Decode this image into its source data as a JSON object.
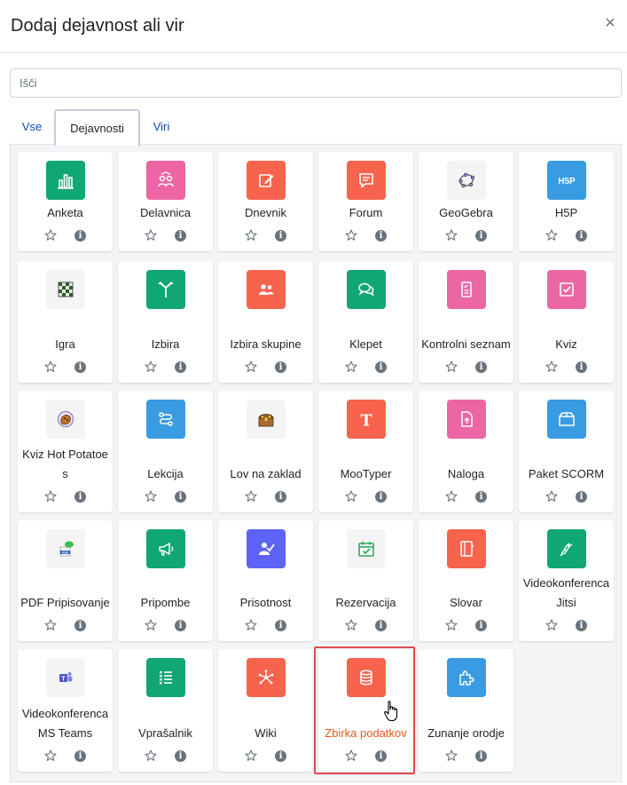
{
  "modal": {
    "title": "Dodaj dejavnost ali vir",
    "close_symbol": "×"
  },
  "search": {
    "placeholder": "Išči"
  },
  "tabs": [
    {
      "label": "Vse"
    },
    {
      "label": "Dejavnosti",
      "active": true
    },
    {
      "label": "Viri"
    }
  ],
  "colors": {
    "assessment": "#f7634d",
    "collaboration": "#eb66a2",
    "communication": "#11a676",
    "content": "#399be2",
    "interactive": "#5d63f6",
    "neutral": "#f4f4f4",
    "highlight_text": "#e6571b",
    "highlight_border": "#e04d4d"
  },
  "activities": [
    {
      "label": "Anketa",
      "icon": "chart-bar-icon",
      "color": "#11a676"
    },
    {
      "label": "Delavnica",
      "icon": "workshop-icon",
      "color": "#eb66a2"
    },
    {
      "label": "Dnevnik",
      "icon": "journal-edit-icon",
      "color": "#f7634d"
    },
    {
      "label": "Forum",
      "icon": "forum-icon",
      "color": "#f7634d"
    },
    {
      "label": "GeoGebra",
      "icon": "geogebra-icon",
      "color": "#f4f4f4"
    },
    {
      "label": "H5P",
      "icon": "h5p-icon",
      "color": "#399be2"
    },
    {
      "label": "Igra",
      "icon": "game-board-icon",
      "color": "#f4f4f4"
    },
    {
      "label": "Izbira",
      "icon": "choice-signpost-icon",
      "color": "#11a676"
    },
    {
      "label": "Izbira skupine",
      "icon": "group-choice-icon",
      "color": "#f7634d"
    },
    {
      "label": "Klepet",
      "icon": "chat-icon",
      "color": "#11a676"
    },
    {
      "label": "Kontrolni seznam",
      "icon": "checklist-icon",
      "color": "#eb66a2"
    },
    {
      "label": "Kviz",
      "icon": "quiz-icon",
      "color": "#eb66a2"
    },
    {
      "label": "Kviz Hot Potatoes",
      "icon": "hot-potatoes-icon",
      "color": "#f4f4f4"
    },
    {
      "label": "Lekcija",
      "icon": "lesson-icon",
      "color": "#399be2"
    },
    {
      "label": "Lov na zaklad",
      "icon": "treasure-chest-icon",
      "color": "#f4f4f4"
    },
    {
      "label": "MooTyper",
      "icon": "mootyper-icon",
      "color": "#f7634d"
    },
    {
      "label": "Naloga",
      "icon": "assignment-icon",
      "color": "#eb66a2"
    },
    {
      "label": "Paket SCORM",
      "icon": "scorm-package-icon",
      "color": "#399be2"
    },
    {
      "label": "PDF Pripisovanje",
      "icon": "pdf-annotation-icon",
      "color": "#f4f4f4"
    },
    {
      "label": "Pripombe",
      "icon": "feedback-megaphone-icon",
      "color": "#11a676"
    },
    {
      "label": "Prisotnost",
      "icon": "attendance-icon",
      "color": "#5d63f6"
    },
    {
      "label": "Rezervacija",
      "icon": "calendar-check-icon",
      "color": "#f4f4f4"
    },
    {
      "label": "Slovar",
      "icon": "glossary-icon",
      "color": "#f7634d"
    },
    {
      "label": "Videokonferenca Jitsi",
      "icon": "jitsi-icon",
      "color": "#11a676"
    },
    {
      "label": "Videokonferenca MS Teams",
      "icon": "ms-teams-icon",
      "color": "#f4f4f4"
    },
    {
      "label": "Vprašalnik",
      "icon": "questionnaire-icon",
      "color": "#11a676"
    },
    {
      "label": "Wiki",
      "icon": "wiki-icon",
      "color": "#f7634d"
    },
    {
      "label": "Zbirka podatkov",
      "icon": "database-icon",
      "color": "#f7634d",
      "highlighted": true
    },
    {
      "label": "Zunanje orodje",
      "icon": "puzzle-icon",
      "color": "#399be2"
    }
  ],
  "card_actions": {
    "star_icon": "star-outline-icon",
    "info_icon": "info-icon",
    "info_symbol": "i"
  }
}
